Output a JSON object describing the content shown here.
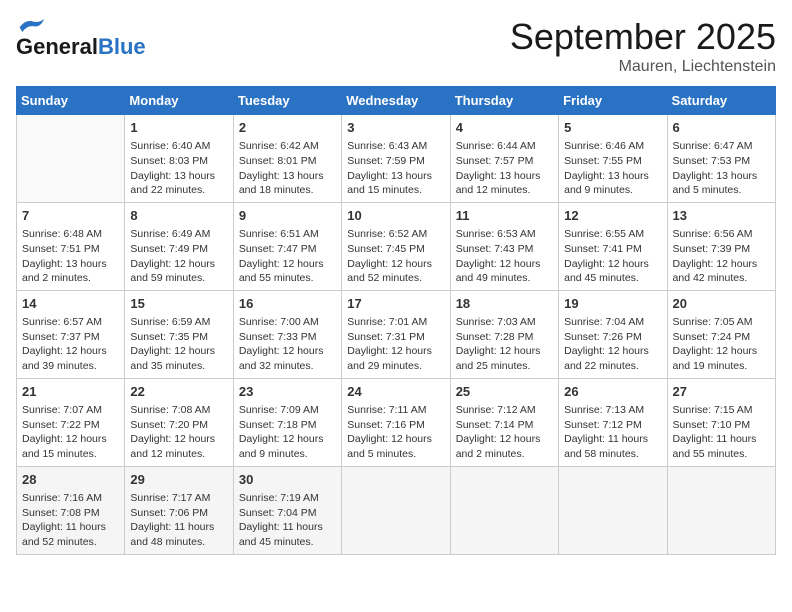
{
  "header": {
    "logo_general": "General",
    "logo_blue": "Blue",
    "month_title": "September 2025",
    "location": "Mauren, Liechtenstein"
  },
  "days_of_week": [
    "Sunday",
    "Monday",
    "Tuesday",
    "Wednesday",
    "Thursday",
    "Friday",
    "Saturday"
  ],
  "weeks": [
    [
      {
        "day": "",
        "sunrise": "",
        "sunset": "",
        "daylight": ""
      },
      {
        "day": "1",
        "sunrise": "Sunrise: 6:40 AM",
        "sunset": "Sunset: 8:03 PM",
        "daylight": "Daylight: 13 hours and 22 minutes."
      },
      {
        "day": "2",
        "sunrise": "Sunrise: 6:42 AM",
        "sunset": "Sunset: 8:01 PM",
        "daylight": "Daylight: 13 hours and 18 minutes."
      },
      {
        "day": "3",
        "sunrise": "Sunrise: 6:43 AM",
        "sunset": "Sunset: 7:59 PM",
        "daylight": "Daylight: 13 hours and 15 minutes."
      },
      {
        "day": "4",
        "sunrise": "Sunrise: 6:44 AM",
        "sunset": "Sunset: 7:57 PM",
        "daylight": "Daylight: 13 hours and 12 minutes."
      },
      {
        "day": "5",
        "sunrise": "Sunrise: 6:46 AM",
        "sunset": "Sunset: 7:55 PM",
        "daylight": "Daylight: 13 hours and 9 minutes."
      },
      {
        "day": "6",
        "sunrise": "Sunrise: 6:47 AM",
        "sunset": "Sunset: 7:53 PM",
        "daylight": "Daylight: 13 hours and 5 minutes."
      }
    ],
    [
      {
        "day": "7",
        "sunrise": "Sunrise: 6:48 AM",
        "sunset": "Sunset: 7:51 PM",
        "daylight": "Daylight: 13 hours and 2 minutes."
      },
      {
        "day": "8",
        "sunrise": "Sunrise: 6:49 AM",
        "sunset": "Sunset: 7:49 PM",
        "daylight": "Daylight: 12 hours and 59 minutes."
      },
      {
        "day": "9",
        "sunrise": "Sunrise: 6:51 AM",
        "sunset": "Sunset: 7:47 PM",
        "daylight": "Daylight: 12 hours and 55 minutes."
      },
      {
        "day": "10",
        "sunrise": "Sunrise: 6:52 AM",
        "sunset": "Sunset: 7:45 PM",
        "daylight": "Daylight: 12 hours and 52 minutes."
      },
      {
        "day": "11",
        "sunrise": "Sunrise: 6:53 AM",
        "sunset": "Sunset: 7:43 PM",
        "daylight": "Daylight: 12 hours and 49 minutes."
      },
      {
        "day": "12",
        "sunrise": "Sunrise: 6:55 AM",
        "sunset": "Sunset: 7:41 PM",
        "daylight": "Daylight: 12 hours and 45 minutes."
      },
      {
        "day": "13",
        "sunrise": "Sunrise: 6:56 AM",
        "sunset": "Sunset: 7:39 PM",
        "daylight": "Daylight: 12 hours and 42 minutes."
      }
    ],
    [
      {
        "day": "14",
        "sunrise": "Sunrise: 6:57 AM",
        "sunset": "Sunset: 7:37 PM",
        "daylight": "Daylight: 12 hours and 39 minutes."
      },
      {
        "day": "15",
        "sunrise": "Sunrise: 6:59 AM",
        "sunset": "Sunset: 7:35 PM",
        "daylight": "Daylight: 12 hours and 35 minutes."
      },
      {
        "day": "16",
        "sunrise": "Sunrise: 7:00 AM",
        "sunset": "Sunset: 7:33 PM",
        "daylight": "Daylight: 12 hours and 32 minutes."
      },
      {
        "day": "17",
        "sunrise": "Sunrise: 7:01 AM",
        "sunset": "Sunset: 7:31 PM",
        "daylight": "Daylight: 12 hours and 29 minutes."
      },
      {
        "day": "18",
        "sunrise": "Sunrise: 7:03 AM",
        "sunset": "Sunset: 7:28 PM",
        "daylight": "Daylight: 12 hours and 25 minutes."
      },
      {
        "day": "19",
        "sunrise": "Sunrise: 7:04 AM",
        "sunset": "Sunset: 7:26 PM",
        "daylight": "Daylight: 12 hours and 22 minutes."
      },
      {
        "day": "20",
        "sunrise": "Sunrise: 7:05 AM",
        "sunset": "Sunset: 7:24 PM",
        "daylight": "Daylight: 12 hours and 19 minutes."
      }
    ],
    [
      {
        "day": "21",
        "sunrise": "Sunrise: 7:07 AM",
        "sunset": "Sunset: 7:22 PM",
        "daylight": "Daylight: 12 hours and 15 minutes."
      },
      {
        "day": "22",
        "sunrise": "Sunrise: 7:08 AM",
        "sunset": "Sunset: 7:20 PM",
        "daylight": "Daylight: 12 hours and 12 minutes."
      },
      {
        "day": "23",
        "sunrise": "Sunrise: 7:09 AM",
        "sunset": "Sunset: 7:18 PM",
        "daylight": "Daylight: 12 hours and 9 minutes."
      },
      {
        "day": "24",
        "sunrise": "Sunrise: 7:11 AM",
        "sunset": "Sunset: 7:16 PM",
        "daylight": "Daylight: 12 hours and 5 minutes."
      },
      {
        "day": "25",
        "sunrise": "Sunrise: 7:12 AM",
        "sunset": "Sunset: 7:14 PM",
        "daylight": "Daylight: 12 hours and 2 minutes."
      },
      {
        "day": "26",
        "sunrise": "Sunrise: 7:13 AM",
        "sunset": "Sunset: 7:12 PM",
        "daylight": "Daylight: 11 hours and 58 minutes."
      },
      {
        "day": "27",
        "sunrise": "Sunrise: 7:15 AM",
        "sunset": "Sunset: 7:10 PM",
        "daylight": "Daylight: 11 hours and 55 minutes."
      }
    ],
    [
      {
        "day": "28",
        "sunrise": "Sunrise: 7:16 AM",
        "sunset": "Sunset: 7:08 PM",
        "daylight": "Daylight: 11 hours and 52 minutes."
      },
      {
        "day": "29",
        "sunrise": "Sunrise: 7:17 AM",
        "sunset": "Sunset: 7:06 PM",
        "daylight": "Daylight: 11 hours and 48 minutes."
      },
      {
        "day": "30",
        "sunrise": "Sunrise: 7:19 AM",
        "sunset": "Sunset: 7:04 PM",
        "daylight": "Daylight: 11 hours and 45 minutes."
      },
      {
        "day": "",
        "sunrise": "",
        "sunset": "",
        "daylight": ""
      },
      {
        "day": "",
        "sunrise": "",
        "sunset": "",
        "daylight": ""
      },
      {
        "day": "",
        "sunrise": "",
        "sunset": "",
        "daylight": ""
      },
      {
        "day": "",
        "sunrise": "",
        "sunset": "",
        "daylight": ""
      }
    ]
  ]
}
